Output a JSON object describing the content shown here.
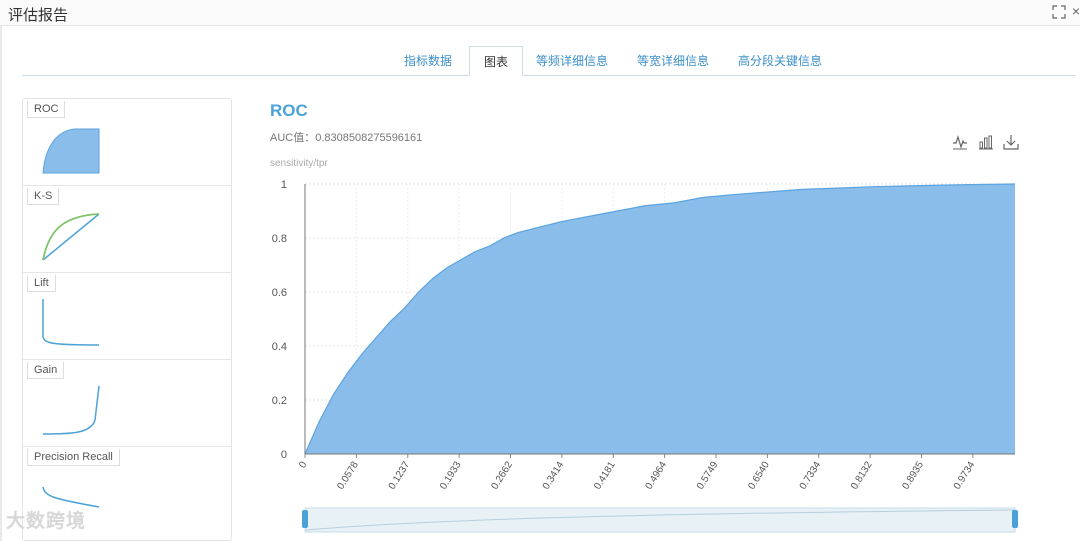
{
  "window": {
    "title": "评估报告"
  },
  "tabs": [
    {
      "label": "指标数据",
      "active": false
    },
    {
      "label": "图表",
      "active": true
    },
    {
      "label": "等频详细信息",
      "active": false
    },
    {
      "label": "等宽详细信息",
      "active": false
    },
    {
      "label": "高分段关键信息",
      "active": false
    }
  ],
  "thumbnails": [
    {
      "label": "ROC",
      "icon": "roc-thumbnail-icon"
    },
    {
      "label": "K-S",
      "icon": "ks-thumbnail-icon"
    },
    {
      "label": "Lift",
      "icon": "lift-thumbnail-icon"
    },
    {
      "label": "Gain",
      "icon": "gain-thumbnail-icon"
    },
    {
      "label": "Precision Recall",
      "icon": "precision-recall-thumbnail-icon"
    }
  ],
  "toolbox": {
    "icons": [
      "line-chart-icon",
      "bar-chart-icon",
      "download-icon"
    ]
  },
  "watermark": "大数跨境",
  "colors": {
    "accent": "#4ba2d8",
    "area_fill": "#8bbdea",
    "area_stroke": "#5aa3e0",
    "tab_link": "#3d8fc8"
  },
  "chart_data": {
    "type": "area",
    "title": "ROC",
    "subtitle": "AUC值：0.8308508275596161",
    "ylabel": "sensitivity/tpr",
    "xlabel": "",
    "ylim": [
      0,
      1
    ],
    "xlim": [
      0,
      1
    ],
    "yticks": [
      "0",
      "0.2",
      "0.4",
      "0.6",
      "0.8",
      "1"
    ],
    "xticks": [
      "0",
      "0.0578",
      "0.1237",
      "0.1933",
      "0.2662",
      "0.3414",
      "0.4181",
      "0.4964",
      "0.5749",
      "0.6540",
      "0.7334",
      "0.8132",
      "0.8935",
      "0.9734"
    ],
    "grid": true,
    "x": [
      0,
      0.02,
      0.04,
      0.06,
      0.08,
      0.1,
      0.12,
      0.14,
      0.16,
      0.18,
      0.2,
      0.22,
      0.24,
      0.26,
      0.28,
      0.3,
      0.33,
      0.36,
      0.4,
      0.44,
      0.48,
      0.52,
      0.56,
      0.6,
      0.65,
      0.7,
      0.75,
      0.8,
      0.85,
      0.9,
      0.95,
      1
    ],
    "y": [
      0,
      0.12,
      0.22,
      0.3,
      0.37,
      0.43,
      0.49,
      0.54,
      0.6,
      0.65,
      0.69,
      0.72,
      0.75,
      0.77,
      0.8,
      0.82,
      0.84,
      0.86,
      0.88,
      0.9,
      0.92,
      0.93,
      0.95,
      0.96,
      0.97,
      0.98,
      0.985,
      0.99,
      0.993,
      0.996,
      0.998,
      1
    ]
  }
}
